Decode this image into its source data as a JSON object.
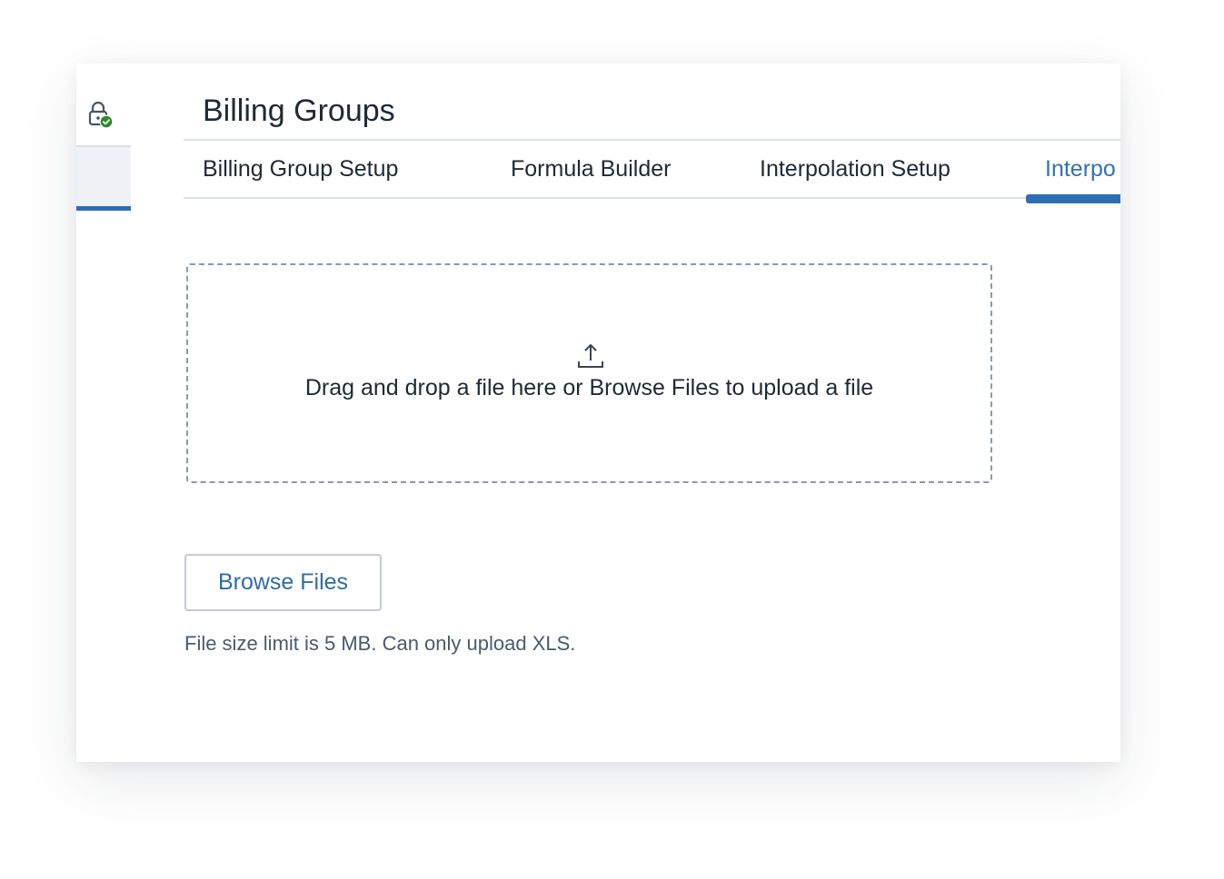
{
  "header": {
    "title": "Billing Groups"
  },
  "tabs": [
    {
      "label": "Billing Group Setup",
      "active": false
    },
    {
      "label": "Formula Builder",
      "active": false
    },
    {
      "label": "Interpolation Setup",
      "active": false
    },
    {
      "label": "Interpo",
      "active": true
    }
  ],
  "rail": {
    "icon": "lock-check-icon",
    "status_color": "#2e8a2e"
  },
  "dropzone": {
    "icon": "upload-icon",
    "text": "Drag and drop a file here or Browse Files to upload a file"
  },
  "actions": {
    "browse_label": "Browse Files"
  },
  "hint": "File size limit is 5 MB. Can only upload XLS.",
  "colors": {
    "accent": "#2f6eb5",
    "link": "#2f74b4",
    "text": "#1f2a36",
    "muted": "#4a5a6c"
  }
}
